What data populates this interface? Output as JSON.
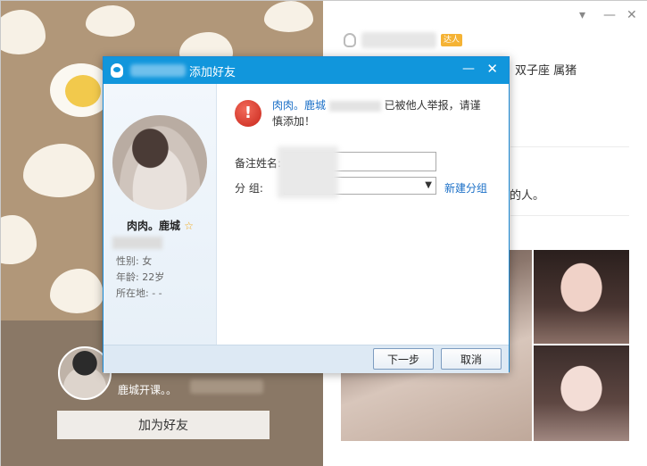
{
  "dialog": {
    "title": "添加好友",
    "minimize_glyph": "—",
    "close_glyph": "✕",
    "profile": {
      "nickname": "肉肉。鹿城",
      "star": "☆",
      "gender": "性别: 女",
      "age": "年龄: 22岁",
      "location": "所在地: -   -"
    },
    "warning": {
      "icon_glyph": "!",
      "name": "肉肉。鹿城",
      "message": "已被他人举报，请谨慎添加！"
    },
    "form": {
      "remark_label": "备注姓名:",
      "remark_value": "",
      "group_label": "分      组:",
      "group_value": "",
      "new_group_link": "新建分组"
    },
    "buttons": {
      "next": "下一步",
      "cancel": "取消"
    }
  },
  "background": {
    "signature": "鹿城开课。。",
    "add_friend_button": "加为好友",
    "badge": "达人",
    "zodiac": "双子座    属猪",
    "text_fragment": "的人。",
    "window_controls": {
      "dropdown": "▾",
      "minimize": "—",
      "close": "✕"
    }
  },
  "icons": [
    "qq-penguin-icon",
    "warning-icon",
    "dropdown-arrow-icon",
    "star-icon"
  ],
  "colors": {
    "titlebar": "#1196dc",
    "link": "#1a6fc7",
    "warning": "#d8342a"
  }
}
